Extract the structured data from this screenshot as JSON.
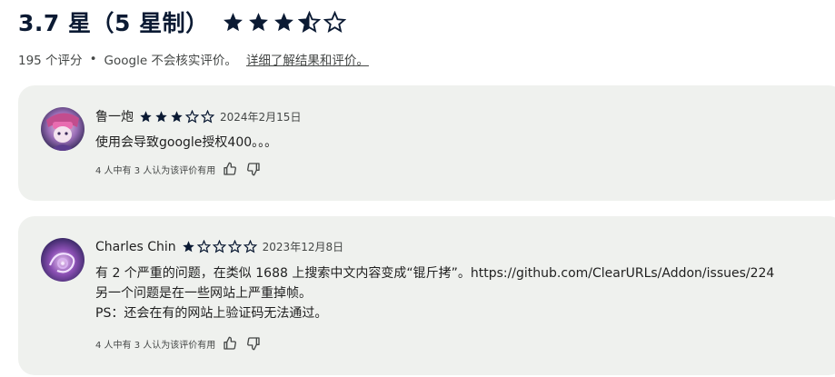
{
  "header": {
    "title": "3.7 星（5 星制）",
    "rating": 3.7,
    "star_color": "#0b1a33"
  },
  "summary": {
    "count_text": "195 个评分",
    "separator": "•",
    "disclaimer": "Google 不会核实评价。",
    "learn_more": "详细了解结果和评价。"
  },
  "reviews": [
    {
      "author": "鲁一炮",
      "stars": 3,
      "date": "2024年2月15日",
      "lines": [
        "使用会导致google授权400。。。"
      ],
      "helpful": "4 人中有 3 人认为该评价有用",
      "avatar_icon": "avatar-anime-character"
    },
    {
      "author": "Charles Chin",
      "stars": 1,
      "date": "2023年12月8日",
      "lines": [
        "有 2 个严重的问题，在类似 1688 上搜索中文内容变成“锟斤拷”。https://github.com/ClearURLs/Addon/issues/224",
        "另一个问题是在一些网站上严重掉帧。",
        "PS：还会在有的网站上验证码无法通过。"
      ],
      "helpful": "4 人中有 3 人认为该评价有用",
      "avatar_icon": "avatar-purple-swirl"
    }
  ],
  "colors": {
    "card_bg": "#eff1ee",
    "text": "#1f1f1f",
    "muted": "#444746"
  }
}
